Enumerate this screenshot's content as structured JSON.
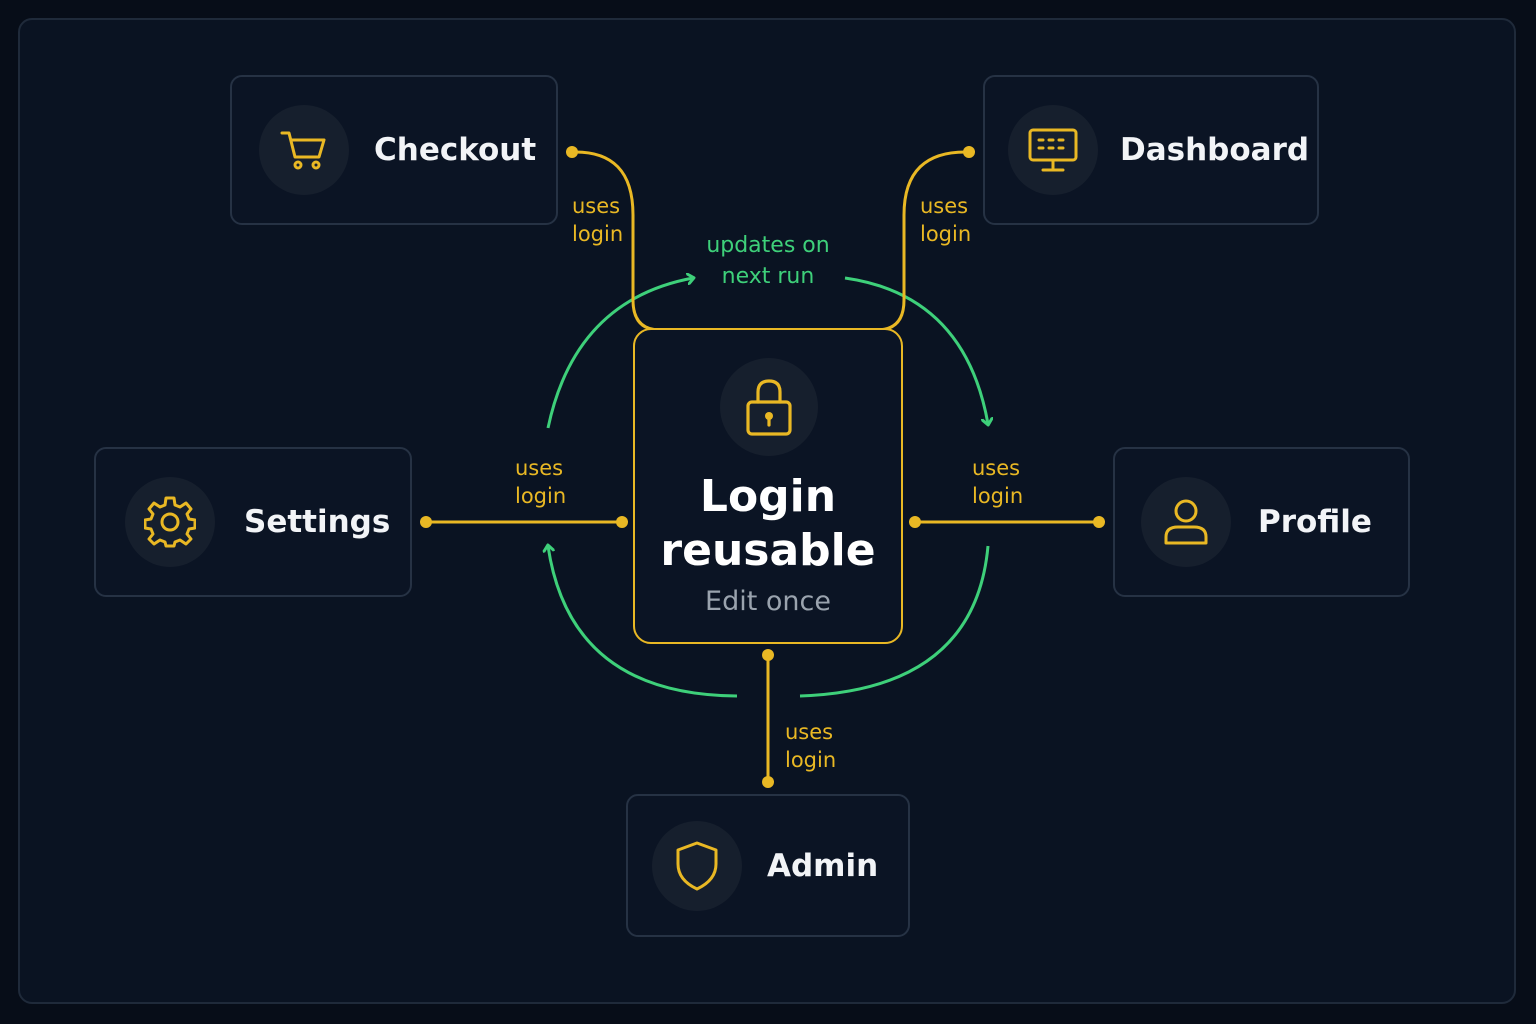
{
  "colors": {
    "background": "#070d18",
    "card_border": "#263244",
    "accent_yellow": "#e9b824",
    "accent_green": "#3ed07a",
    "text_primary": "#f2f4f7",
    "text_muted": "#9aa3ae"
  },
  "center_node": {
    "icon": "lock-icon",
    "title_line1": "Login",
    "title_line2": "reusable",
    "subtitle": "Edit once"
  },
  "nodes": {
    "checkout": {
      "label": "Checkout",
      "icon": "cart-icon"
    },
    "dashboard": {
      "label": "Dashboard",
      "icon": "monitor-icon"
    },
    "settings": {
      "label": "Settings",
      "icon": "gear-icon"
    },
    "profile": {
      "label": "Profile",
      "icon": "user-icon"
    },
    "admin": {
      "label": "Admin",
      "icon": "shield-icon"
    }
  },
  "edge_labels": {
    "checkout": {
      "line1": "uses",
      "line2": "login"
    },
    "dashboard": {
      "line1": "uses",
      "line2": "login"
    },
    "settings": {
      "line1": "uses",
      "line2": "login"
    },
    "profile": {
      "line1": "uses",
      "line2": "login"
    },
    "admin": {
      "line1": "uses",
      "line2": "login"
    }
  },
  "flow_label": {
    "line1": "updates on",
    "line2": "next run"
  }
}
